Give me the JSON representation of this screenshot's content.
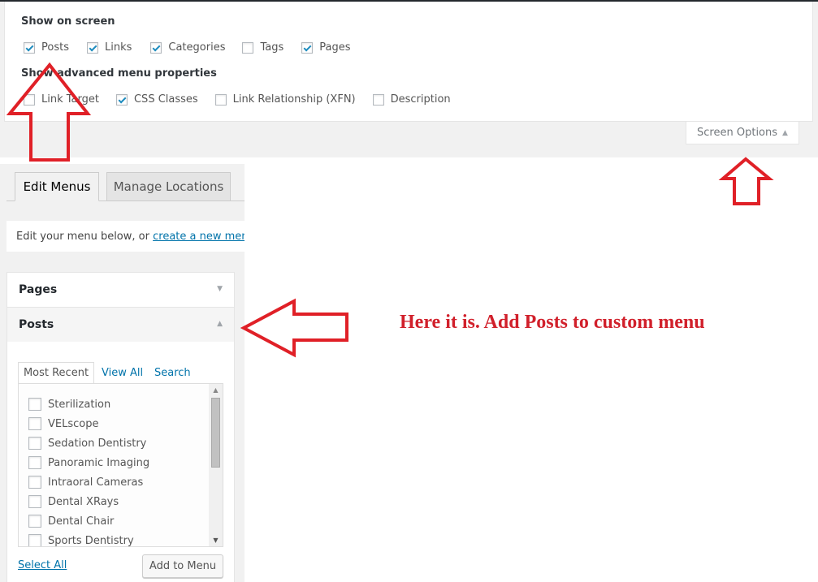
{
  "screen_options": {
    "show_on_screen_label": "Show on screen",
    "show_on_screen": [
      {
        "label": "Posts",
        "checked": true
      },
      {
        "label": "Links",
        "checked": true
      },
      {
        "label": "Categories",
        "checked": true
      },
      {
        "label": "Tags",
        "checked": false
      },
      {
        "label": "Pages",
        "checked": true
      }
    ],
    "advanced_label": "Show advanced menu properties",
    "advanced": [
      {
        "label": "Link Target",
        "checked": false
      },
      {
        "label": "CSS Classes",
        "checked": true
      },
      {
        "label": "Link Relationship (XFN)",
        "checked": false
      },
      {
        "label": "Description",
        "checked": false
      }
    ],
    "toggle_button_label": "Screen Options",
    "toggle_arrow": "▲"
  },
  "tabs": {
    "edit_menus": "Edit Menus",
    "manage_locations": "Manage Locations"
  },
  "notice": {
    "text": "Edit your menu below, or ",
    "link": "create a new menu",
    "suffix": "."
  },
  "accordion": {
    "pages": {
      "title": "Pages",
      "arrow": "▼"
    },
    "posts": {
      "title": "Posts",
      "arrow": "▲"
    }
  },
  "posts_panel": {
    "tabs": [
      "Most Recent",
      "View All",
      "Search"
    ],
    "items": [
      {
        "label": "Sterilization",
        "checked": false
      },
      {
        "label": "VELscope",
        "checked": false
      },
      {
        "label": "Sedation Dentistry",
        "checked": false
      },
      {
        "label": "Panoramic Imaging",
        "checked": false
      },
      {
        "label": "Intraoral Cameras",
        "checked": false
      },
      {
        "label": "Dental XRays",
        "checked": false
      },
      {
        "label": "Dental Chair",
        "checked": false
      },
      {
        "label": "Sports Dentistry",
        "checked": false
      }
    ],
    "select_all": "Select All",
    "add_button": "Add to Menu"
  },
  "annotation": {
    "text": "Here it is. Add Posts to custom menu",
    "color": "#d1202b"
  }
}
